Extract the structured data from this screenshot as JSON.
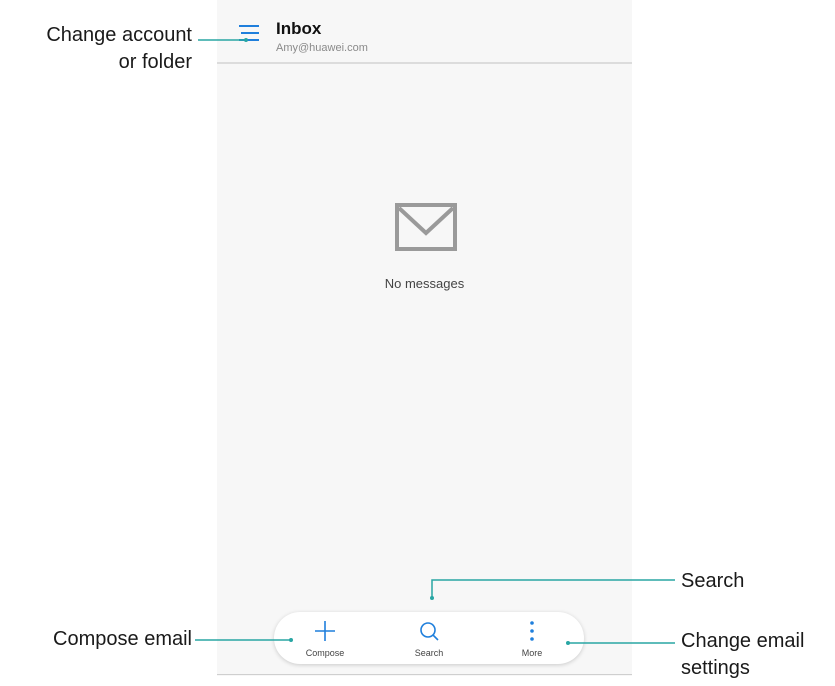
{
  "header": {
    "title": "Inbox",
    "account": "Amy@huawei.com"
  },
  "empty_state": {
    "icon": "envelope-icon",
    "message": "No messages"
  },
  "bottom_bar": {
    "compose_label": "Compose",
    "search_label": "Search",
    "more_label": "More"
  },
  "annotations": {
    "change_account_line1": "Change account",
    "change_account_line2": "or folder",
    "search": "Search",
    "compose_email": "Compose email",
    "change_settings_line1": "Change email",
    "change_settings_line2": "settings"
  },
  "colors": {
    "callout": "#28a6a4",
    "accent": "#1f7fdc",
    "background": "#f7f7f7"
  }
}
